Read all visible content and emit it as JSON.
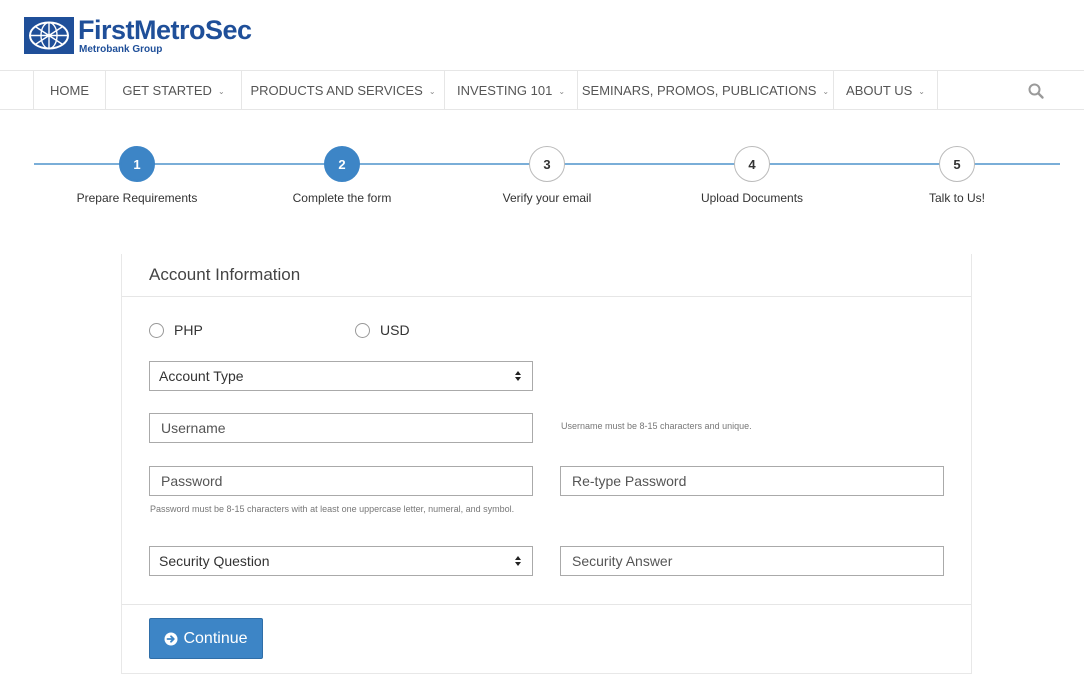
{
  "brand": {
    "name": "FirstMetroSec",
    "tagline": "Metrobank Group",
    "color": "#1f4f99"
  },
  "nav": {
    "items": [
      {
        "label": "HOME",
        "has_dropdown": false
      },
      {
        "label": "GET STARTED",
        "has_dropdown": true
      },
      {
        "label": "PRODUCTS AND SERVICES",
        "has_dropdown": true
      },
      {
        "label": "INVESTING 101",
        "has_dropdown": true
      },
      {
        "label": "SEMINARS, PROMOS, PUBLICATIONS",
        "has_dropdown": true
      },
      {
        "label": "ABOUT US",
        "has_dropdown": true
      }
    ],
    "chevron": "⌄",
    "search_icon": "search-icon"
  },
  "stepper": {
    "accent": "#3d85c6",
    "steps": [
      {
        "number": "1",
        "label": "Prepare Requirements",
        "state": "active"
      },
      {
        "number": "2",
        "label": "Complete the form",
        "state": "active"
      },
      {
        "number": "3",
        "label": "Verify your email",
        "state": "pending"
      },
      {
        "number": "4",
        "label": "Upload Documents",
        "state": "pending"
      },
      {
        "number": "5",
        "label": "Talk to Us!",
        "state": "pending"
      }
    ]
  },
  "form": {
    "title": "Account Information",
    "currency": {
      "options": [
        "PHP",
        "USD"
      ],
      "selected": null
    },
    "account_type": {
      "selected": "Account Type"
    },
    "username": {
      "value": "",
      "placeholder": "Username",
      "help": "Username must be 8-15 characters and unique."
    },
    "password": {
      "value": "",
      "placeholder": "Password",
      "help": "Password must be 8-15 characters with at least one uppercase letter, numeral, and symbol."
    },
    "retype_password": {
      "value": "",
      "placeholder": "Re-type Password"
    },
    "security_question": {
      "selected": "Security Question"
    },
    "security_answer": {
      "value": "",
      "placeholder": "Security Answer"
    },
    "continue_label": "Continue",
    "continue_icon": "arrow-circle-right-icon",
    "button_color": "#3d85c6"
  }
}
